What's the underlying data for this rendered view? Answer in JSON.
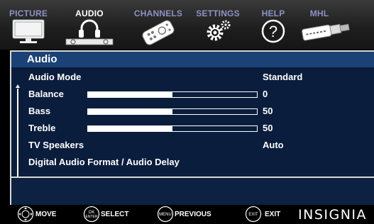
{
  "tabs": [
    {
      "label": "PICTURE",
      "icon": "tv-icon",
      "active": false
    },
    {
      "label": "AUDIO",
      "icon": "headphones-icon",
      "active": true
    },
    {
      "label": "CHANNELS",
      "icon": "remote-icon",
      "active": false
    },
    {
      "label": "SETTINGS",
      "icon": "gears-icon",
      "active": false
    },
    {
      "label": "HELP",
      "icon": "question-icon",
      "active": false
    },
    {
      "label": "MHL",
      "icon": "mhl-cable-icon",
      "active": false
    }
  ],
  "panel": {
    "title": "Audio",
    "rows": [
      {
        "label": "Audio Mode",
        "value": "Standard"
      },
      {
        "label": "Balance",
        "value": "0",
        "level": 0.5
      },
      {
        "label": "Bass",
        "value": "50",
        "level": 0.5
      },
      {
        "label": "Treble",
        "value": "50",
        "level": 0.5
      },
      {
        "label": "TV Speakers",
        "value": "Auto"
      },
      {
        "label": "Digital Audio Format / Audio Delay",
        "value": ""
      }
    ]
  },
  "hints": [
    {
      "icon": "dpad-icon",
      "label": "MOVE"
    },
    {
      "icon": "ok-enter-icon",
      "icon_text_top": "OK",
      "icon_text_bottom": "ENTER",
      "label": "SELECT"
    },
    {
      "icon": "menu-button-icon",
      "icon_text": "MENU",
      "label": "PREVIOUS"
    },
    {
      "icon": "exit-button-icon",
      "icon_text": "EXIT",
      "label": "EXIT"
    }
  ],
  "brand": "INSIGNIA",
  "colors": {
    "tab_inactive": "#8c93c4",
    "tab_active": "#ffffff",
    "panel_header": "#1b4276",
    "panel_body": "#0a1d3c"
  }
}
